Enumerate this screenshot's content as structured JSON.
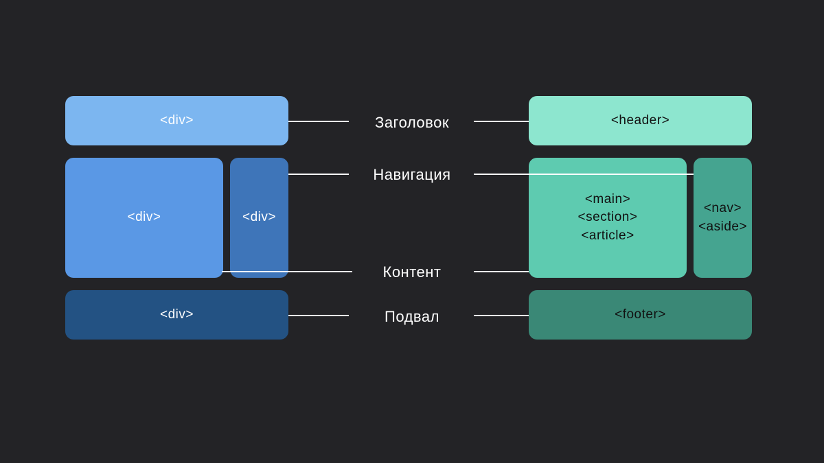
{
  "colors": {
    "bg": "#232326",
    "blue1": "#7CB6F0",
    "blue2": "#5A98E5",
    "blue3": "#3E75B9",
    "blue4": "#235283",
    "teal1": "#8DE6CF",
    "teal2": "#5ECBB0",
    "teal3": "#45A490",
    "teal4": "#3A8876"
  },
  "left": {
    "header": "<div>",
    "main": "<div>",
    "nav": "<div>",
    "footer": "<div>"
  },
  "right": {
    "header": "<header>",
    "main_line1": "<main>",
    "main_line2": "<section>",
    "main_line3": "<article>",
    "nav_line1": "<nav>",
    "nav_line2": "<aside>",
    "footer": "<footer>"
  },
  "labels": {
    "header": "Заголовок",
    "nav": "Навигация",
    "content": "Контент",
    "footer": "Подвал"
  }
}
